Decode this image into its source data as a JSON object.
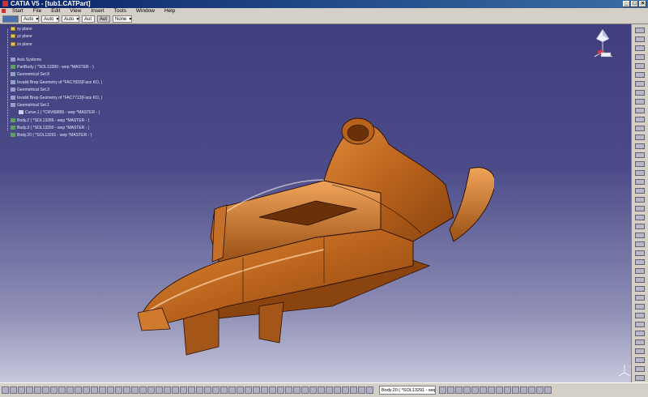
{
  "window": {
    "title": "CATIA V5 - [tub1.CATPart]",
    "controls": [
      "_",
      "□",
      "×"
    ]
  },
  "menu": [
    "Start",
    "File",
    "Edit",
    "View",
    "Insert",
    "Tools",
    "Window",
    "Help"
  ],
  "toolbar": {
    "combo1": "Auto",
    "combo2": "Auto",
    "combo3": "Auto",
    "combo4": "Aut",
    "combo5": "Aut",
    "combo6": "None"
  },
  "tree": [
    {
      "label": "xy plane",
      "icon": "plane"
    },
    {
      "label": "yz plane",
      "icon": "plane"
    },
    {
      "label": "zx plane",
      "icon": "plane"
    },
    {
      "label": "",
      "icon": ""
    },
    {
      "label": "Axis Systems",
      "icon": "geo"
    },
    {
      "label": "PartBody ( *SOL13280 - wep *MASTER - )",
      "icon": "body"
    },
    {
      "label": "Geometrical Set.8",
      "icon": "geo"
    },
    {
      "label": "Invalid Brep Geometry of *FAC7833(Face KO, )",
      "icon": "geo"
    },
    {
      "label": "Geometrical Set.3",
      "icon": "geo"
    },
    {
      "label": "Invalid Brep Geometry of *FAC7713(Face KO, )",
      "icon": "geo"
    },
    {
      "label": "Geometrical Set.1",
      "icon": "geo"
    },
    {
      "label": "Curve.1 ( *CRV68885 - wep *MASTER - )",
      "icon": "curve"
    },
    {
      "label": "Body.2 ( *SOL13286 - wep *MASTER - )",
      "icon": "body"
    },
    {
      "label": "Body.3 ( *SOL13290 - wep *MASTER - )",
      "icon": "body"
    },
    {
      "label": "Body.20 ( *SOL13291 - wep *MASTER - )",
      "icon": "body"
    }
  ],
  "status": {
    "current_body": "Body.20 ( *SOL13291 - wep"
  },
  "colors": {
    "bg_top": "#3f3f7d",
    "bg_bottom": "#c7c7dc",
    "part_fill": "#b8621c"
  },
  "logo_text": "CATIA"
}
